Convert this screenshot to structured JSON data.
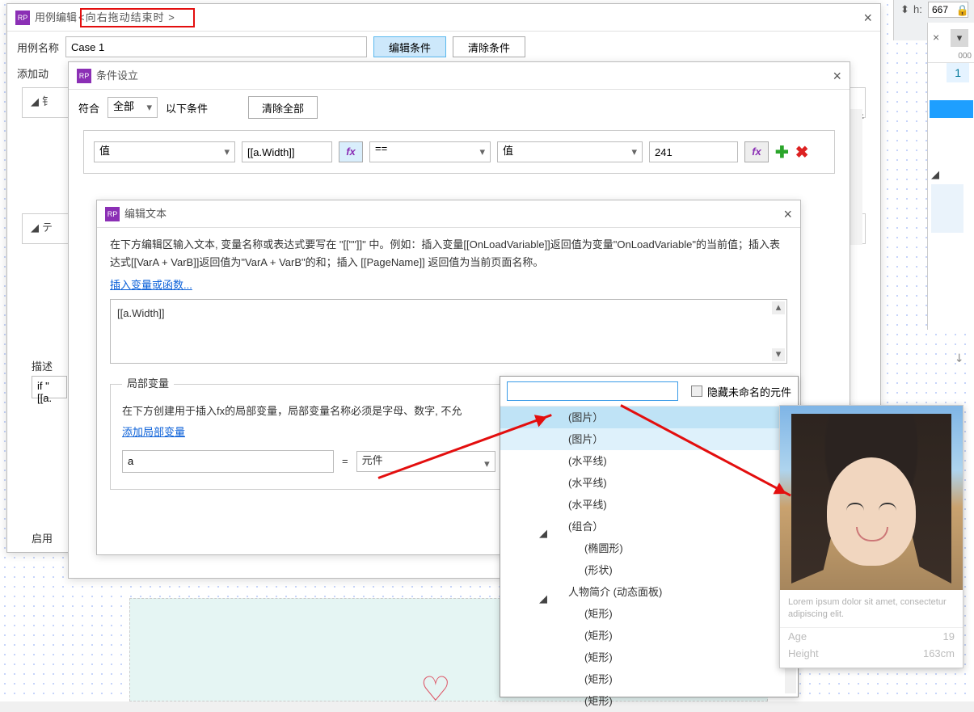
{
  "right_frag": {
    "h_label": "h:",
    "h_value": "667"
  },
  "right_tabs": {
    "tabnum": "1"
  },
  "d1": {
    "title_prefix": "用例编辑",
    "title_event": "<向右拖动结束时 >",
    "case_name_label": "用例名称",
    "case_name_value": "Case 1",
    "btn_edit_cond": "编辑条件",
    "btn_clear_cond": "清除条件",
    "add_action_label": "添加动",
    "tree1": "钅",
    "tree2": "テ",
    "desc_label": "描述",
    "if_expr": "if \"[[a.",
    "yuanjian": "元件",
    "enable": "启用"
  },
  "d2": {
    "title": "条件设立",
    "match_label": "符合",
    "match_all": "全部",
    "match_suffix": "以下条件",
    "btn_clear_all": "清除全部",
    "left_type": "值",
    "left_value": "[[a.Width]]",
    "operator": "==",
    "right_type": "值",
    "right_value": "241",
    "fx": "fx"
  },
  "d3": {
    "title": "编辑文本",
    "instructions": "在下方编辑区输入文本, 变量名称或表达式要写在 \"[[\"\"]]\" 中。例如：插入变量[[OnLoadVariable]]返回值为变量\"OnLoadVariable\"的当前值；插入表达式[[VarA + VarB]]返回值为\"VarA + VarB\"的和；插入 [[PageName]] 返回值为当前页面名称。",
    "link_insert": "插入变量或函数...",
    "expr_value": "[[a.Width]]",
    "local_var_legend": "局部变量",
    "local_var_hint": "在下方创建用于插入fx的局部变量，局部变量名称必须是字母、数字, 不允",
    "link_add_var": "添加局部变量",
    "var_name": "a",
    "eq": "=",
    "var_type": "元件"
  },
  "popup": {
    "hide_unnamed": "隐藏未命名的元件",
    "items": [
      "(图片）",
      "(图片）",
      "(水平线)",
      "(水平线)",
      "(水平线)",
      "(组合）",
      "(椭圆形)",
      "(形状)",
      "人物简介 (动态面板)",
      "(矩形)",
      "(矩形)",
      "(矩形)",
      "(矩形)",
      "(矩形)"
    ]
  },
  "card": {
    "lorem": "Lorem ipsum dolor sit amet, consectetur adipiscing elit.",
    "age_label": "Age",
    "age_value": "19",
    "height_label": "Height",
    "height_value": "163cm"
  }
}
